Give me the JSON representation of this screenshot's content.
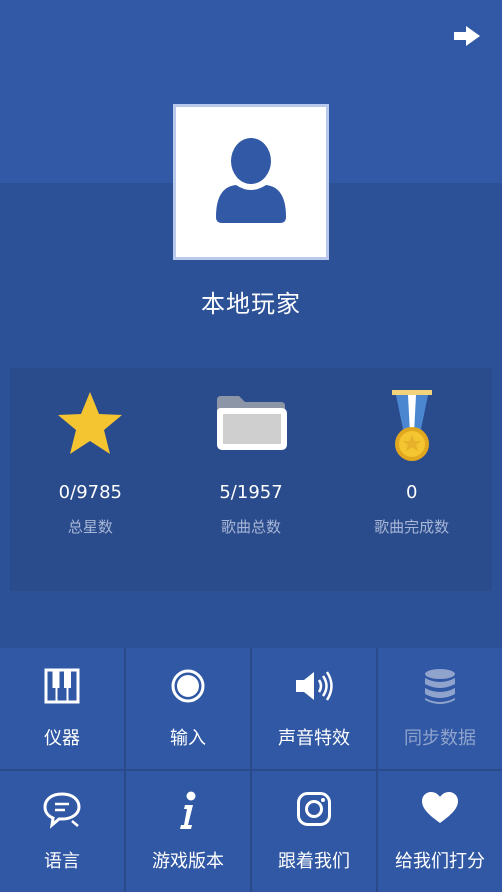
{
  "profile": {
    "name": "本地玩家"
  },
  "stats": [
    {
      "value": "0/9785",
      "label": "总星数",
      "icon": "star-icon"
    },
    {
      "value": "5/1957",
      "label": "歌曲总数",
      "icon": "folder-icon"
    },
    {
      "value": "0",
      "label": "歌曲完成数",
      "icon": "medal-icon"
    }
  ],
  "menu": [
    {
      "label": "仪器",
      "icon": "piano-icon",
      "enabled": true
    },
    {
      "label": "输入",
      "icon": "record-icon",
      "enabled": true
    },
    {
      "label": "声音特效",
      "icon": "speaker-icon",
      "enabled": true
    },
    {
      "label": "同步数据",
      "icon": "database-icon",
      "enabled": false
    },
    {
      "label": "语言",
      "icon": "chat-icon",
      "enabled": true
    },
    {
      "label": "游戏版本",
      "icon": "info-icon",
      "enabled": true
    },
    {
      "label": "跟着我们",
      "icon": "instagram-icon",
      "enabled": true
    },
    {
      "label": "给我们打分",
      "icon": "heart-icon",
      "enabled": true
    }
  ],
  "colors": {
    "background": "#2f539a",
    "accent_gold": "#f5c431",
    "muted_text": "#a7b6d6"
  }
}
